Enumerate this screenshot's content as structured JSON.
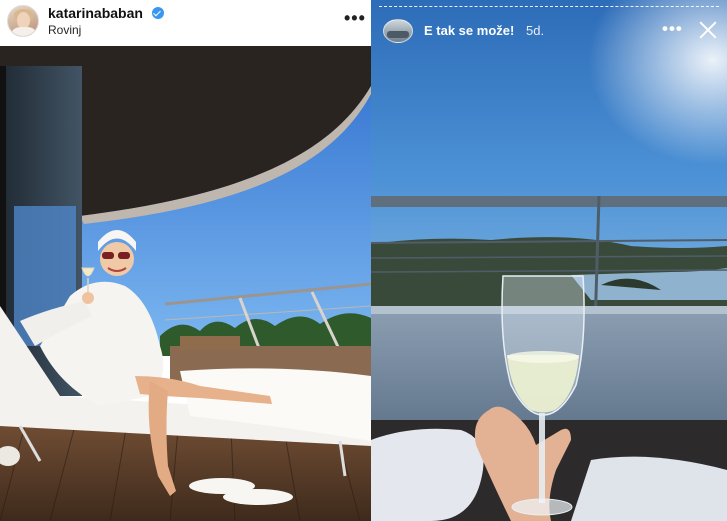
{
  "post": {
    "username": "katarinababan",
    "location": "Rovinj",
    "more_icon": "more-dots-icon",
    "verified_icon": "verified-badge-icon",
    "more_label": "•••"
  },
  "story": {
    "title": "E tak se može!",
    "age": "5d.",
    "more_label": "•••",
    "more_icon": "more-dots-icon",
    "close_icon": "close-icon"
  },
  "colors": {
    "verified": "#3897f0",
    "sky": "#3f86d6",
    "deck": "#6b4a33"
  }
}
